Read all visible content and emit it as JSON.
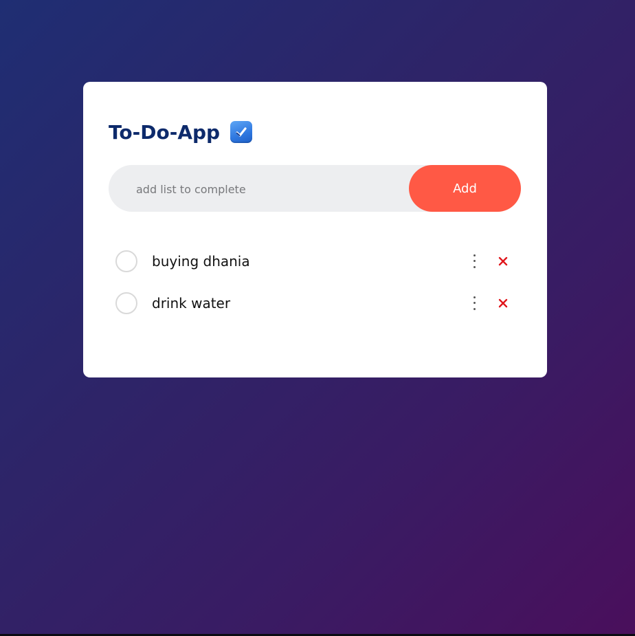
{
  "app": {
    "title": "To-Do-App",
    "title_icon": "checkbox-icon"
  },
  "colors": {
    "title": "#0d2a6b",
    "add_button": "#ff5945",
    "delete": "#e0161b",
    "input_bg": "#edeef0"
  },
  "input": {
    "value": "",
    "placeholder": "add list to complete"
  },
  "add_button": {
    "label": "Add"
  },
  "tasks": [
    {
      "text": "buying dhania",
      "completed": false,
      "more_icon": "more-vertical-icon",
      "delete_icon": "close-icon"
    },
    {
      "text": "drink water",
      "completed": false,
      "more_icon": "more-vertical-icon",
      "delete_icon": "close-icon"
    }
  ]
}
